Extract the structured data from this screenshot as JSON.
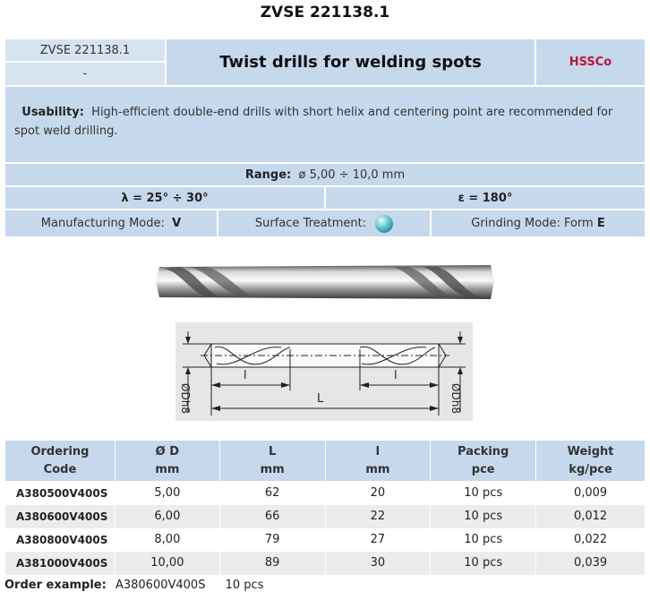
{
  "page_title": "ZVSE 221138.1",
  "header": {
    "code": "ZVSE 221138.1",
    "code_sub": "-",
    "product_name": "Twist drills for welding spots",
    "material": "HSSCo"
  },
  "usability": {
    "label": "Usability:",
    "text": "High-efficient double-end drills with short helix and centering point are recommended for spot weld drilling."
  },
  "range": {
    "label": "Range:",
    "value": "ø 5,00 ÷ 10,0 mm"
  },
  "angles": {
    "lambda": "λ = 25° ÷ 30°",
    "epsilon": "ε = 180°"
  },
  "modes": {
    "manufacturing_label": "Manufacturing Mode:",
    "manufacturing_value": "V",
    "surface_label": "Surface Treatment:",
    "surface_icon": "coating-sphere-icon",
    "grinding_label": "Grinding Mode: Form",
    "grinding_value": "E"
  },
  "drawing": {
    "dim_l_small": "l",
    "dim_l_small_right": "l",
    "dim_L": "L",
    "dim_d_left": "ØDh8",
    "dim_d_right": "ØDh8"
  },
  "table": {
    "headers": [
      {
        "line1": "Ordering",
        "line2": "Code"
      },
      {
        "line1": "Ø D",
        "line2": "mm"
      },
      {
        "line1": "L",
        "line2": "mm"
      },
      {
        "line1": "l",
        "line2": "mm"
      },
      {
        "line1": "Packing",
        "line2": "pce"
      },
      {
        "line1": "Weight",
        "line2": "kg/pce"
      }
    ],
    "rows": [
      {
        "code": "A380500V400S",
        "d": "5,00",
        "L": "62",
        "l": "20",
        "packing": "10 pcs",
        "weight": "0,009"
      },
      {
        "code": "A380600V400S",
        "d": "6,00",
        "L": "66",
        "l": "22",
        "packing": "10 pcs",
        "weight": "0,012"
      },
      {
        "code": "A380800V400S",
        "d": "8,00",
        "L": "79",
        "l": "27",
        "packing": "10 pcs",
        "weight": "0,022"
      },
      {
        "code": "A381000V400S",
        "d": "10,00",
        "L": "89",
        "l": "30",
        "packing": "10 pcs",
        "weight": "0,039"
      }
    ]
  },
  "order_example": {
    "label": "Order example:",
    "code": "A380600V400S",
    "qty": "10 pcs"
  }
}
